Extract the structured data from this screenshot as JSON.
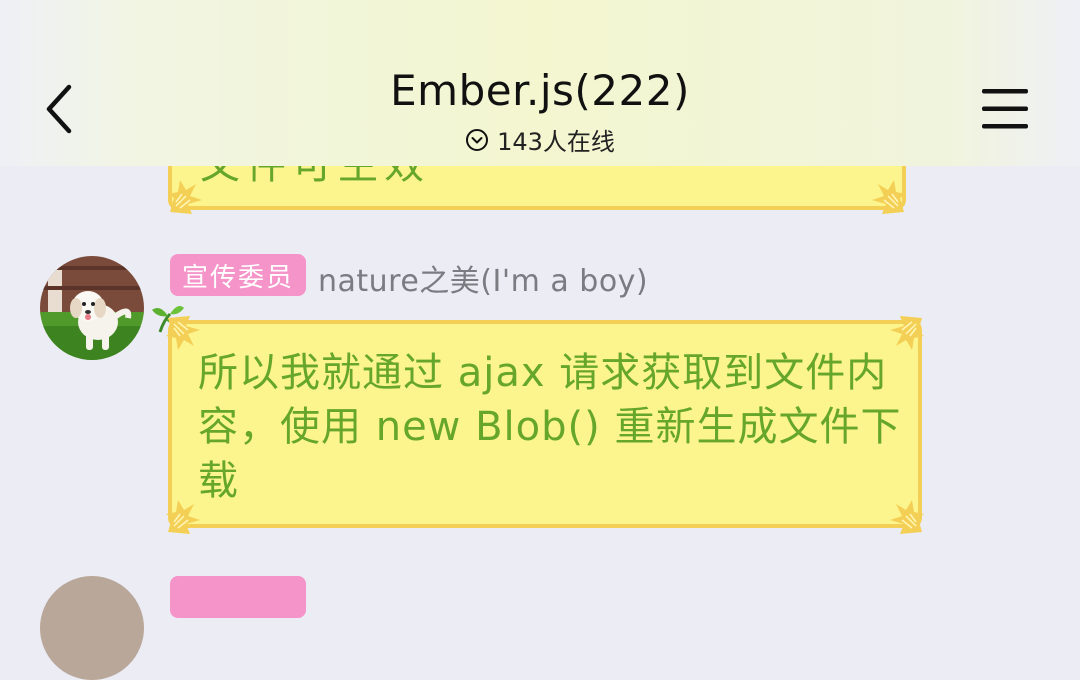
{
  "header": {
    "title": "Ember.js(222)",
    "online_text": "143人在线",
    "back_icon": "chevron-left-icon",
    "menu_icon": "hamburger-menu-icon",
    "online_icon": "circle-chevron-down-icon"
  },
  "messages": [
    {
      "text": "文件可生效",
      "partial": true
    },
    {
      "badge": "宣传委员",
      "sender": "nature之美(I'm a boy)",
      "avatar_icon": "puppy-avatar",
      "text": "所以我就通过 ajax 请求获取到文件内容，使用 new Blob() 重新生成文件下载"
    }
  ],
  "colors": {
    "bubble_fill": "#fcf58e",
    "bubble_border": "#f4cf55",
    "bubble_text": "#66a62a",
    "badge": "#f594c9",
    "chat_bg": "#ececf4"
  }
}
